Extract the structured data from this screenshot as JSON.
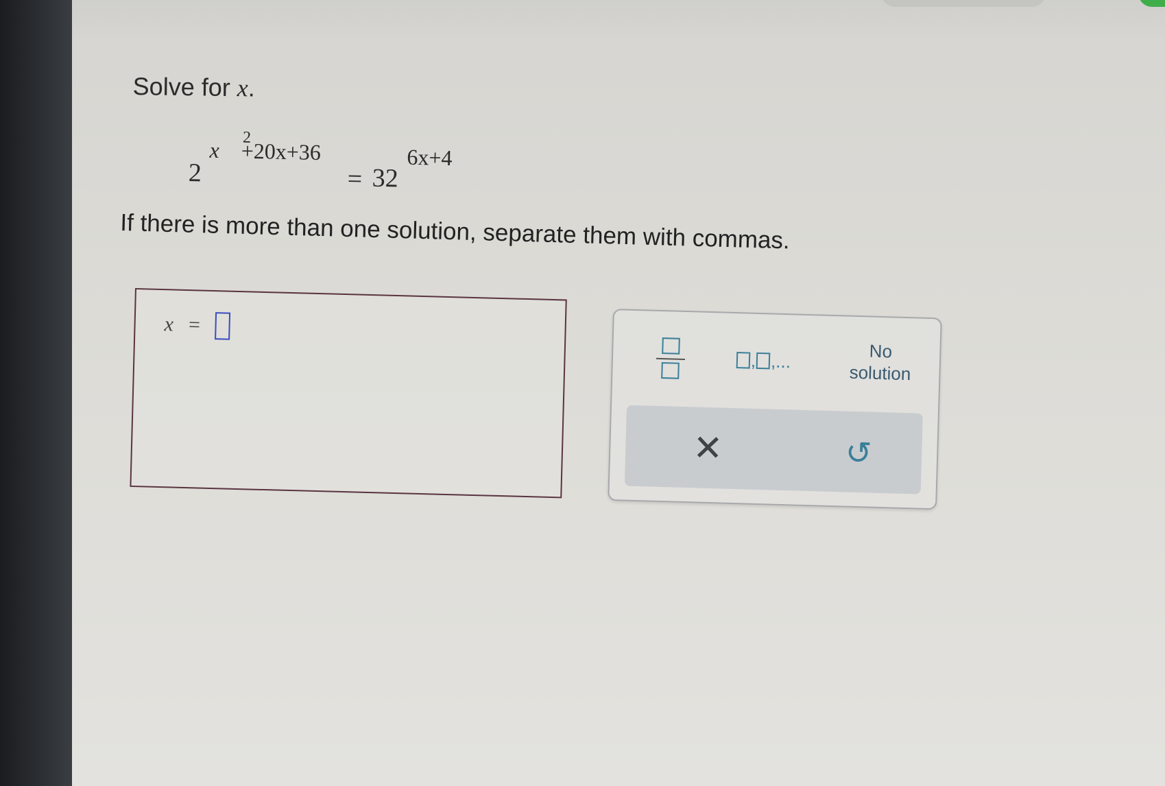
{
  "prompt": {
    "text": "Solve for ",
    "variable": "x",
    "period": "."
  },
  "equation": {
    "base_left": "2",
    "exp_left_var": "x",
    "exp_left_square": "2",
    "exp_left_rest": "+20x+36",
    "equals": "=",
    "base_right": "32",
    "exp_right": "6x+4"
  },
  "instruction": "If there is more than one solution, separate them with commas.",
  "answer": {
    "variable": "x",
    "equals": "=",
    "value": ""
  },
  "keypad": {
    "fraction_icon": "fraction-template-icon",
    "list_icon": "comma-list-template-icon",
    "list_ellipsis": ",...",
    "no_solution_line1": "No",
    "no_solution_line2": "solution",
    "clear_symbol": "✕",
    "undo_symbol": "↺"
  },
  "colors": {
    "template_blue": "#3a7f99",
    "input_border": "#3a4cc0",
    "answer_box_border": "#5a3340",
    "keypad_bottom": "#c9cccf",
    "top_green_button": "#3fae4a"
  }
}
